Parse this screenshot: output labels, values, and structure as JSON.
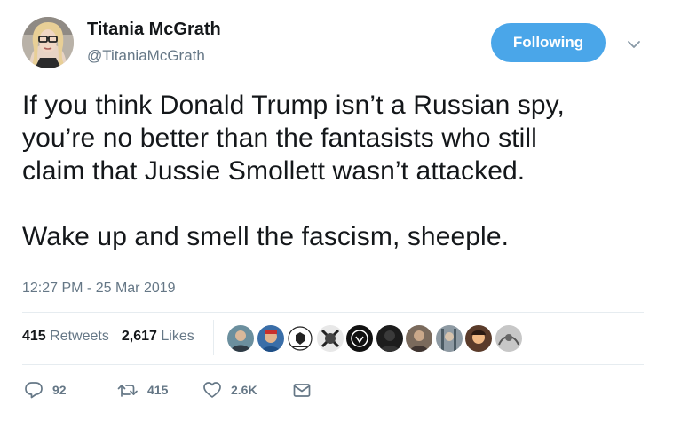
{
  "user": {
    "display_name": "Titania McGrath",
    "handle": "@TitaniaMcGrath",
    "avatar_icon": "profile-photo"
  },
  "follow_button": {
    "label": "Following",
    "color": "#4aa6e9"
  },
  "menu_icon": "chevron-down-icon",
  "tweet": {
    "lines_paragraph_1": [
      "If you think Donald Trump isn’t a Russian spy,",
      "you’re no better than the fantasists who still",
      "claim that Jussie Smollett wasn’t attacked."
    ],
    "lines_paragraph_2": [
      "Wake up and smell the fascism, sheeple."
    ],
    "timestamp": "12:27 PM - 25 Mar 2019"
  },
  "stats": {
    "retweets_count": "415",
    "retweets_label": "Retweets",
    "likes_count": "2,617",
    "likes_label": "Likes"
  },
  "liker_avatars": [
    "liker-avatar-1",
    "liker-avatar-2",
    "liker-avatar-3",
    "liker-avatar-4",
    "liker-avatar-5",
    "liker-avatar-6",
    "liker-avatar-7",
    "liker-avatar-8",
    "liker-avatar-9",
    "liker-avatar-10"
  ],
  "actions": {
    "replies": "92",
    "retweets": "415",
    "likes": "2.6K"
  },
  "colors": {
    "text": "#14171a",
    "muted": "#657786",
    "divider": "#e6ecf0",
    "accent": "#1da1f2"
  }
}
